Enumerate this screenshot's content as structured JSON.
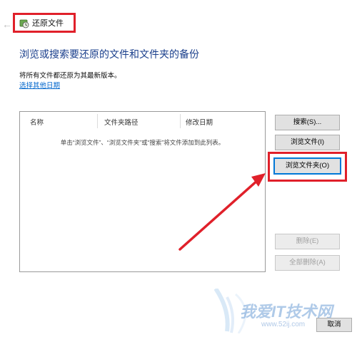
{
  "window": {
    "title": "还原文件"
  },
  "main": {
    "heading": "浏览或搜索要还原的文件和文件夹的备份",
    "subtext": "将所有文件都还原为其最新版本。",
    "choose_date_link": "选择其他日期"
  },
  "file_list": {
    "columns": [
      "名称",
      "文件夹路径",
      "修改日期"
    ],
    "empty_hint": "单击“浏览文件”、“浏览文件夹”或“搜索”将文件添加到此列表。"
  },
  "buttons": {
    "search": "搜索(S)...",
    "browse_files": "浏览文件(I)",
    "browse_folder": "浏览文件夹(O)",
    "delete": "删除(E)",
    "delete_all": "全部删除(A)",
    "cancel": "取消"
  },
  "watermark": {
    "text": "我爱IT技术网",
    "url": "www.52ij.com"
  },
  "colors": {
    "heading": "#1a3f8c",
    "link": "#0066cc",
    "annotation_red": "#e0202a",
    "focus_blue": "#0078d7"
  }
}
